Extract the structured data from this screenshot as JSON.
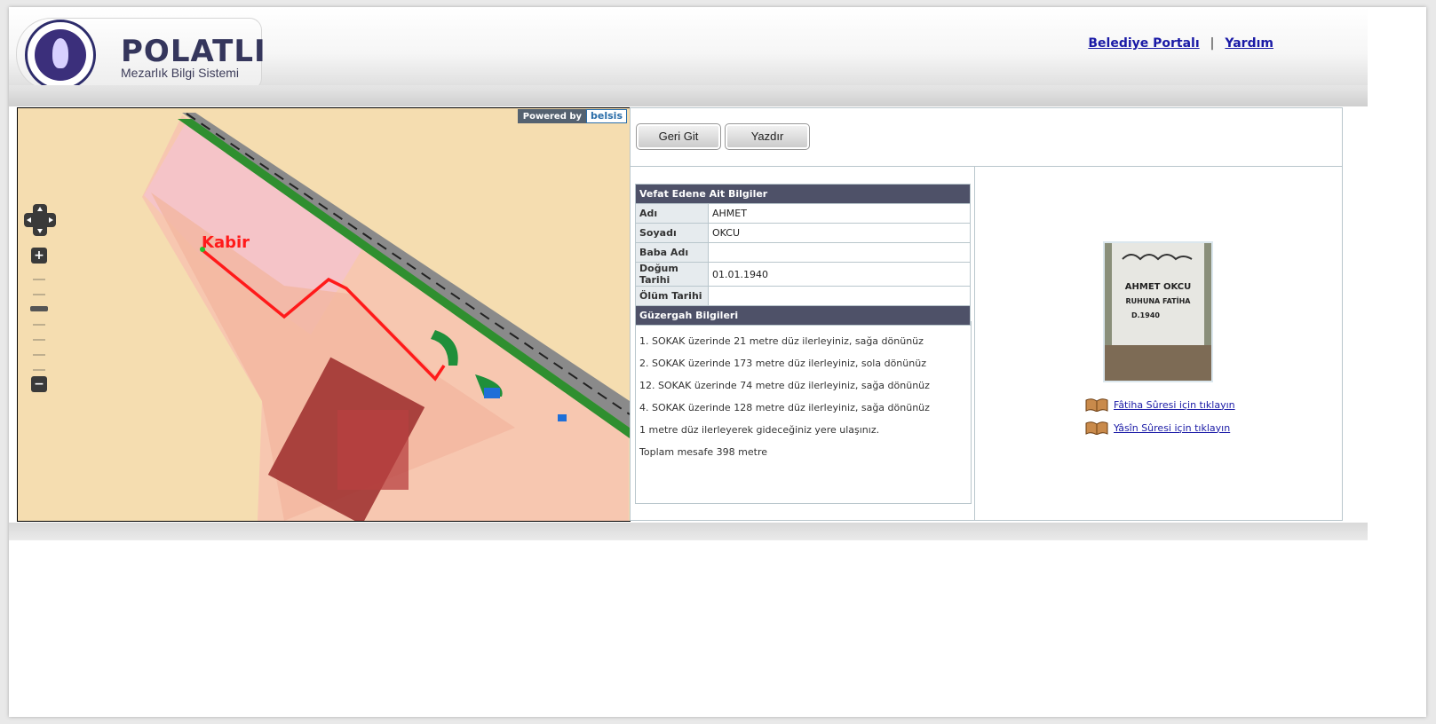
{
  "header": {
    "logo_title": "POLATLI",
    "logo_subtitle": "Mezarlık Bilgi Sistemi",
    "links": {
      "portal": "Belediye Portalı",
      "separator": "|",
      "help": "Yardım"
    }
  },
  "map": {
    "powered_label": "Powered by",
    "powered_brand": "belsis",
    "marker_label": "Kabir",
    "zoom_in": "+",
    "zoom_out": "−"
  },
  "toolbar": {
    "back_label": "Geri Git",
    "print_label": "Yazdır"
  },
  "deceased": {
    "section_title": "Vefat Edene Ait Bilgiler",
    "rows": [
      {
        "key": "Adı",
        "value": "AHMET"
      },
      {
        "key": "Soyadı",
        "value": "OKCU"
      },
      {
        "key": "Baba Adı",
        "value": ""
      },
      {
        "key": "Doğum Tarihi",
        "value": "01.01.1940"
      },
      {
        "key": "Ölüm Tarihi",
        "value": ""
      }
    ]
  },
  "route": {
    "section_title": "Güzergah Bilgileri",
    "steps": [
      "1. SOKAK üzerinde 21 metre düz ilerleyiniz, sağa dönünüz",
      "2. SOKAK üzerinde 173 metre düz ilerleyiniz, sola dönünüz",
      "12. SOKAK üzerinde 74 metre düz ilerleyiniz, sağa dönünüz",
      "4. SOKAK üzerinde 128 metre düz ilerleyiniz, sağa dönünüz",
      "1 metre düz ilerleyerek gideceğiniz yere ulaşınız.",
      "Toplam mesafe 398 metre"
    ]
  },
  "photo": {
    "line1": "AHMET OKCU",
    "line2": "RUHUNA FATİHA",
    "line3": "D.1940"
  },
  "prayers": {
    "fatiha": "Fâtiha Sûresi için tıklayın",
    "yasin": "Yâsîn Sûresi için tıklayın"
  },
  "colors": {
    "header_bar": "#4e5168",
    "route_line": "#ff1a1a",
    "link": "#1a1aa6"
  }
}
